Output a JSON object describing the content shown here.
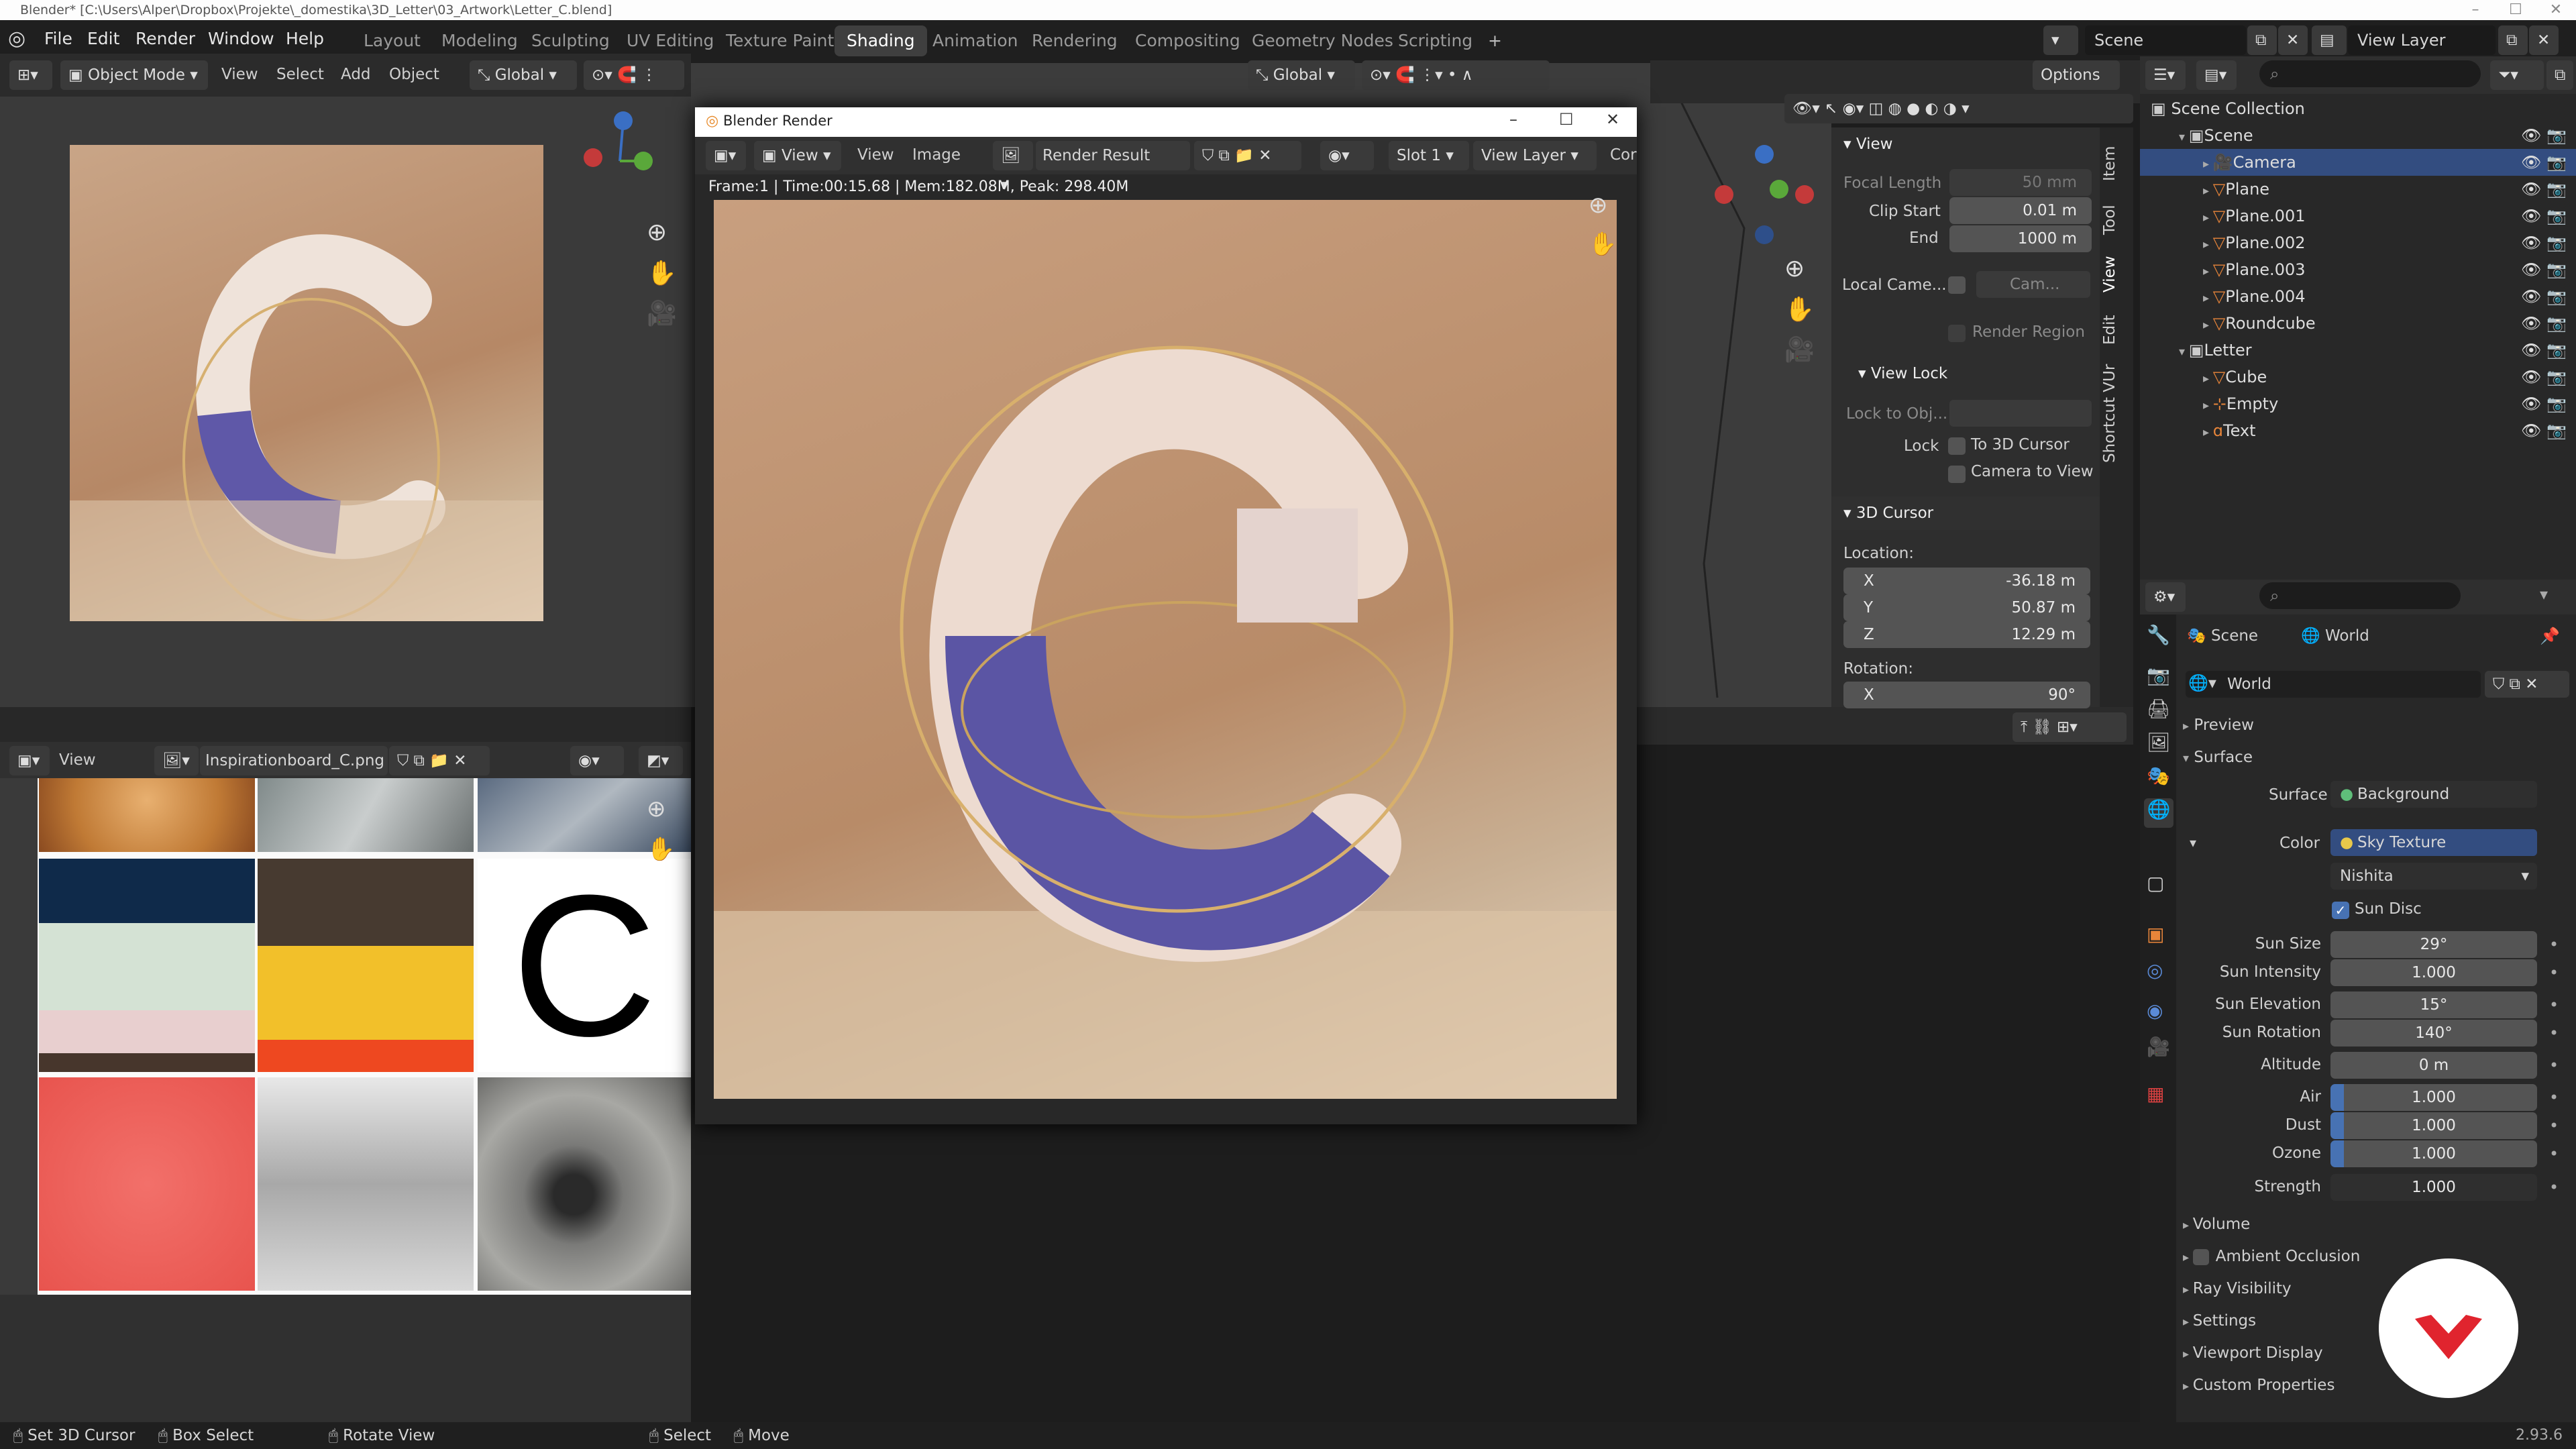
{
  "window_title": "Blender* [C:\\Users\\Alper\\Dropbox\\Projekte\\_domestika\\3D_Letter\\03_Artwork\\Letter_C.blend]",
  "menu": [
    "File",
    "Edit",
    "Render",
    "Window",
    "Help"
  ],
  "workspaces": [
    "Layout",
    "Modeling",
    "Sculpting",
    "UV Editing",
    "Texture Paint",
    "Shading",
    "Animation",
    "Rendering",
    "Compositing",
    "Geometry Nodes",
    "Scripting"
  ],
  "active_workspace": "Shading",
  "scene_name": "Scene",
  "view_layer_name": "View Layer",
  "viewport_header": {
    "mode": "Object Mode",
    "items": [
      "View",
      "Select",
      "Add",
      "Object"
    ],
    "orientation": "Global",
    "orientation2": "Global",
    "options": "Options"
  },
  "render_window": {
    "title": "Blender Render",
    "menus": [
      "View",
      "View",
      "Image"
    ],
    "result": "Render Result",
    "slot": "Slot 1",
    "view_layer": "View Layer",
    "extra": "Cor",
    "info": "Frame:1 | Time:00:15.68 | Mem:182.08M, Peak: 298.40M"
  },
  "image_editor": {
    "view": "View",
    "image_name": "Inspirationboard_C.png",
    "letter": "C"
  },
  "n_panel": {
    "tabs": [
      "Item",
      "Tool",
      "View",
      "Edit",
      "Shortcut VUr"
    ],
    "view_title": "View",
    "focal_length_label": "Focal Length",
    "focal_length": "50 mm",
    "clip_start_label": "Clip Start",
    "clip_start": "0.01 m",
    "end_label": "End",
    "end": "1000 m",
    "local_camera_label": "Local Came...",
    "local_camera": "Cam...",
    "render_region": "Render Region",
    "view_lock_title": "View Lock",
    "lock_obj_label": "Lock to Obj...",
    "lock_label": "Lock",
    "to_3d_cursor": "To 3D Cursor",
    "camera_to_view": "Camera to View",
    "cursor_title": "3D Cursor",
    "location_label": "Location:",
    "x_label": "X",
    "x": "-36.18 m",
    "y_label": "Y",
    "y": "50.87 m",
    "z_label": "Z",
    "z": "12.29 m",
    "rotation_label": "Rotation:",
    "rx_label": "X",
    "rx": "90°"
  },
  "outliner": {
    "root": "Scene Collection",
    "rows": [
      {
        "name": "Scene",
        "indent": 1
      },
      {
        "name": "Camera",
        "indent": 2
      },
      {
        "name": "Plane",
        "indent": 2
      },
      {
        "name": "Plane.001",
        "indent": 2
      },
      {
        "name": "Plane.002",
        "indent": 2
      },
      {
        "name": "Plane.003",
        "indent": 2
      },
      {
        "name": "Plane.004",
        "indent": 2
      },
      {
        "name": "Roundcube",
        "indent": 2
      },
      {
        "name": "Letter",
        "indent": 1
      },
      {
        "name": "Cube",
        "indent": 2
      },
      {
        "name": "Empty",
        "indent": 2
      },
      {
        "name": "Text",
        "indent": 2
      }
    ]
  },
  "properties": {
    "crumb_scene": "Scene",
    "crumb_world": "World",
    "world_name": "World",
    "preview": "Preview",
    "surface_section": "Surface",
    "surface_label": "Surface",
    "surface_value": "Background",
    "color_label": "Color",
    "color_value": "Sky Texture",
    "sky_type": "Nishita",
    "sun_disc": "Sun Disc",
    "rows": [
      {
        "label": "Sun Size",
        "value": "29°"
      },
      {
        "label": "Sun Intensity",
        "value": "1.000"
      },
      {
        "label": "Sun Elevation",
        "value": "15°"
      },
      {
        "label": "Sun Rotation",
        "value": "140°"
      },
      {
        "label": "Altitude",
        "value": "0 m"
      },
      {
        "label": "Air",
        "value": "1.000"
      },
      {
        "label": "Dust",
        "value": "1.000"
      },
      {
        "label": "Ozone",
        "value": "1.000"
      },
      {
        "label": "Strength",
        "value": "1.000"
      }
    ],
    "sections": [
      "Volume",
      "Ambient Occlusion",
      "Ray Visibility",
      "Settings",
      "Viewport Display",
      "Custom Properties"
    ]
  },
  "status_bar": {
    "items": [
      "Set 3D Cursor",
      "Box Select",
      "Rotate View",
      "Select",
      "Move"
    ],
    "version": "2.93.6"
  },
  "colors": {
    "accent": "#4772b3",
    "selected": "#334d80",
    "brand": "#e0242e",
    "mesh": "#e8853a",
    "data": "#5fbf7a"
  }
}
